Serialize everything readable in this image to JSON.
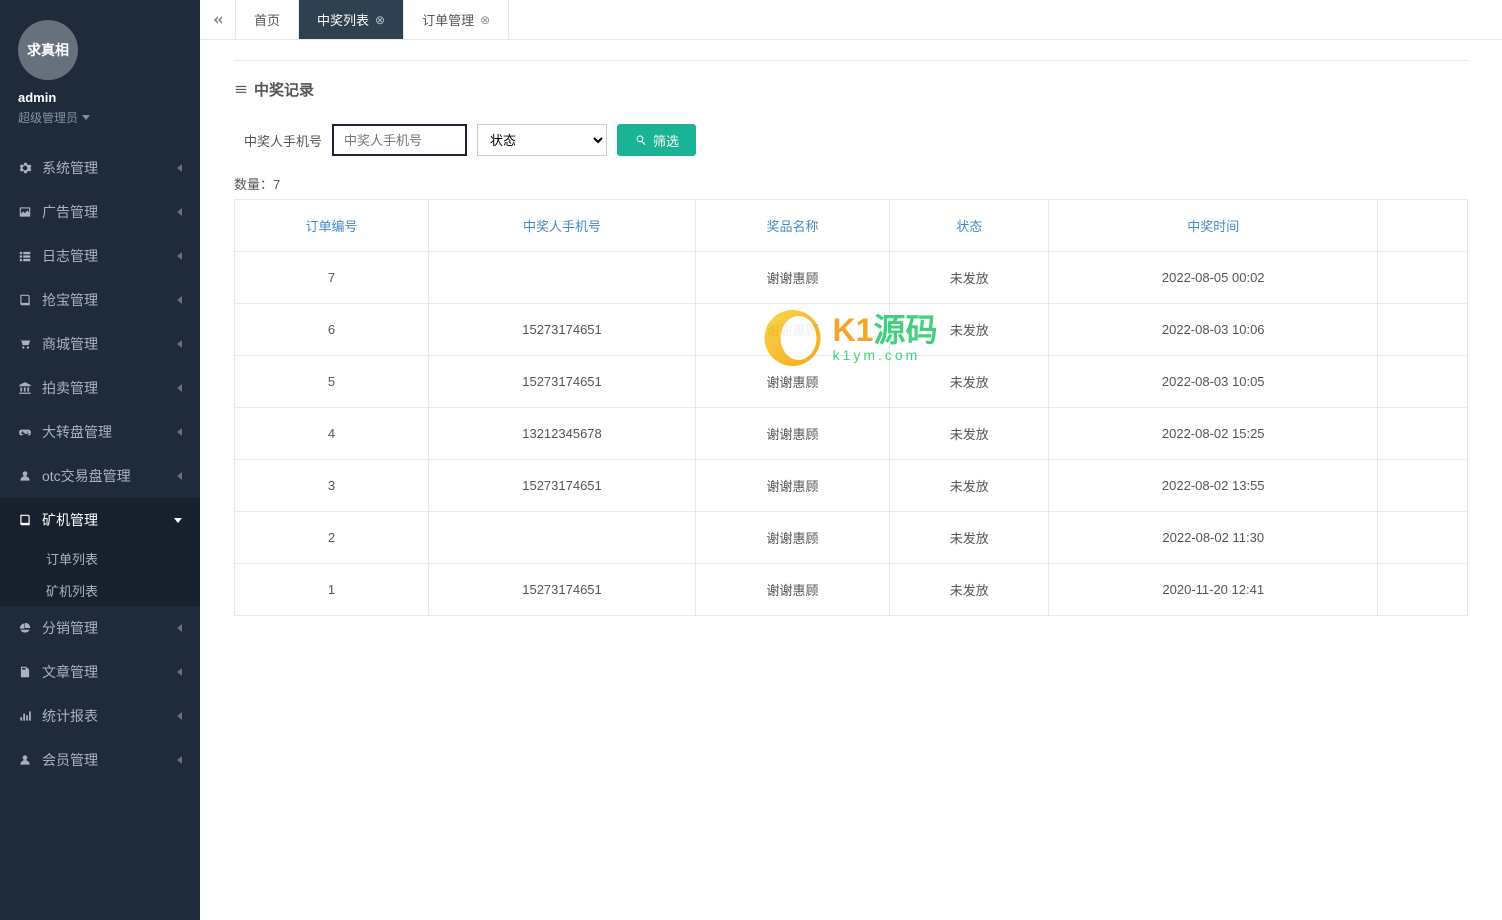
{
  "user": {
    "name": "admin",
    "role": "超级管理员",
    "avatar_watermark": "求真相"
  },
  "sidebar": {
    "items": [
      {
        "label": "系统管理",
        "icon": "gear-icon"
      },
      {
        "label": "广告管理",
        "icon": "image-icon"
      },
      {
        "label": "日志管理",
        "icon": "list-icon"
      },
      {
        "label": "抢宝管理",
        "icon": "book-icon"
      },
      {
        "label": "商城管理",
        "icon": "cart-icon"
      },
      {
        "label": "拍卖管理",
        "icon": "bank-icon"
      },
      {
        "label": "大转盘管理",
        "icon": "gamepad-icon"
      },
      {
        "label": "otc交易盘管理",
        "icon": "user-icon"
      },
      {
        "label": "矿机管理",
        "icon": "book-icon",
        "active": true,
        "children": [
          {
            "label": "订单列表"
          },
          {
            "label": "矿机列表"
          }
        ]
      },
      {
        "label": "分销管理",
        "icon": "dashboard-icon"
      },
      {
        "label": "文章管理",
        "icon": "doc-icon"
      },
      {
        "label": "统计报表",
        "icon": "bar-icon"
      },
      {
        "label": "会员管理",
        "icon": "user-icon"
      }
    ]
  },
  "tabs": [
    {
      "label": "首页",
      "closable": false
    },
    {
      "label": "中奖列表",
      "closable": true,
      "active": true
    },
    {
      "label": "订单管理",
      "closable": true
    }
  ],
  "panel": {
    "title": "中奖记录"
  },
  "filter": {
    "phone_label": "中奖人手机号",
    "phone_placeholder": "中奖人手机号",
    "status_default": "状态",
    "button": "筛选"
  },
  "table": {
    "count_label": "数量：",
    "count": "7",
    "columns": [
      "订单编号",
      "中奖人手机号",
      "奖品名称",
      "状态",
      "中奖时间",
      ""
    ],
    "rows": [
      {
        "id": "7",
        "phone": "",
        "prize": "谢谢惠顾",
        "status": "未发放",
        "time": "2022-08-05 00:02"
      },
      {
        "id": "6",
        "phone": "15273174651",
        "prize": "谢谢惠顾",
        "status": "未发放",
        "time": "2022-08-03 10:06"
      },
      {
        "id": "5",
        "phone": "15273174651",
        "prize": "谢谢惠顾",
        "status": "未发放",
        "time": "2022-08-03 10:05"
      },
      {
        "id": "4",
        "phone": "13212345678",
        "prize": "谢谢惠顾",
        "status": "未发放",
        "time": "2022-08-02 15:25"
      },
      {
        "id": "3",
        "phone": "15273174651",
        "prize": "谢谢惠顾",
        "status": "未发放",
        "time": "2022-08-02 13:55"
      },
      {
        "id": "2",
        "phone": "",
        "prize": "谢谢惠顾",
        "status": "未发放",
        "time": "2022-08-02 11:30"
      },
      {
        "id": "1",
        "phone": "15273174651",
        "prize": "谢谢惠顾",
        "status": "未发放",
        "time": "2020-11-20 12:41"
      }
    ]
  },
  "watermark": {
    "brand_k": "K1",
    "brand_y": "源码",
    "url": "k1ym.com"
  }
}
